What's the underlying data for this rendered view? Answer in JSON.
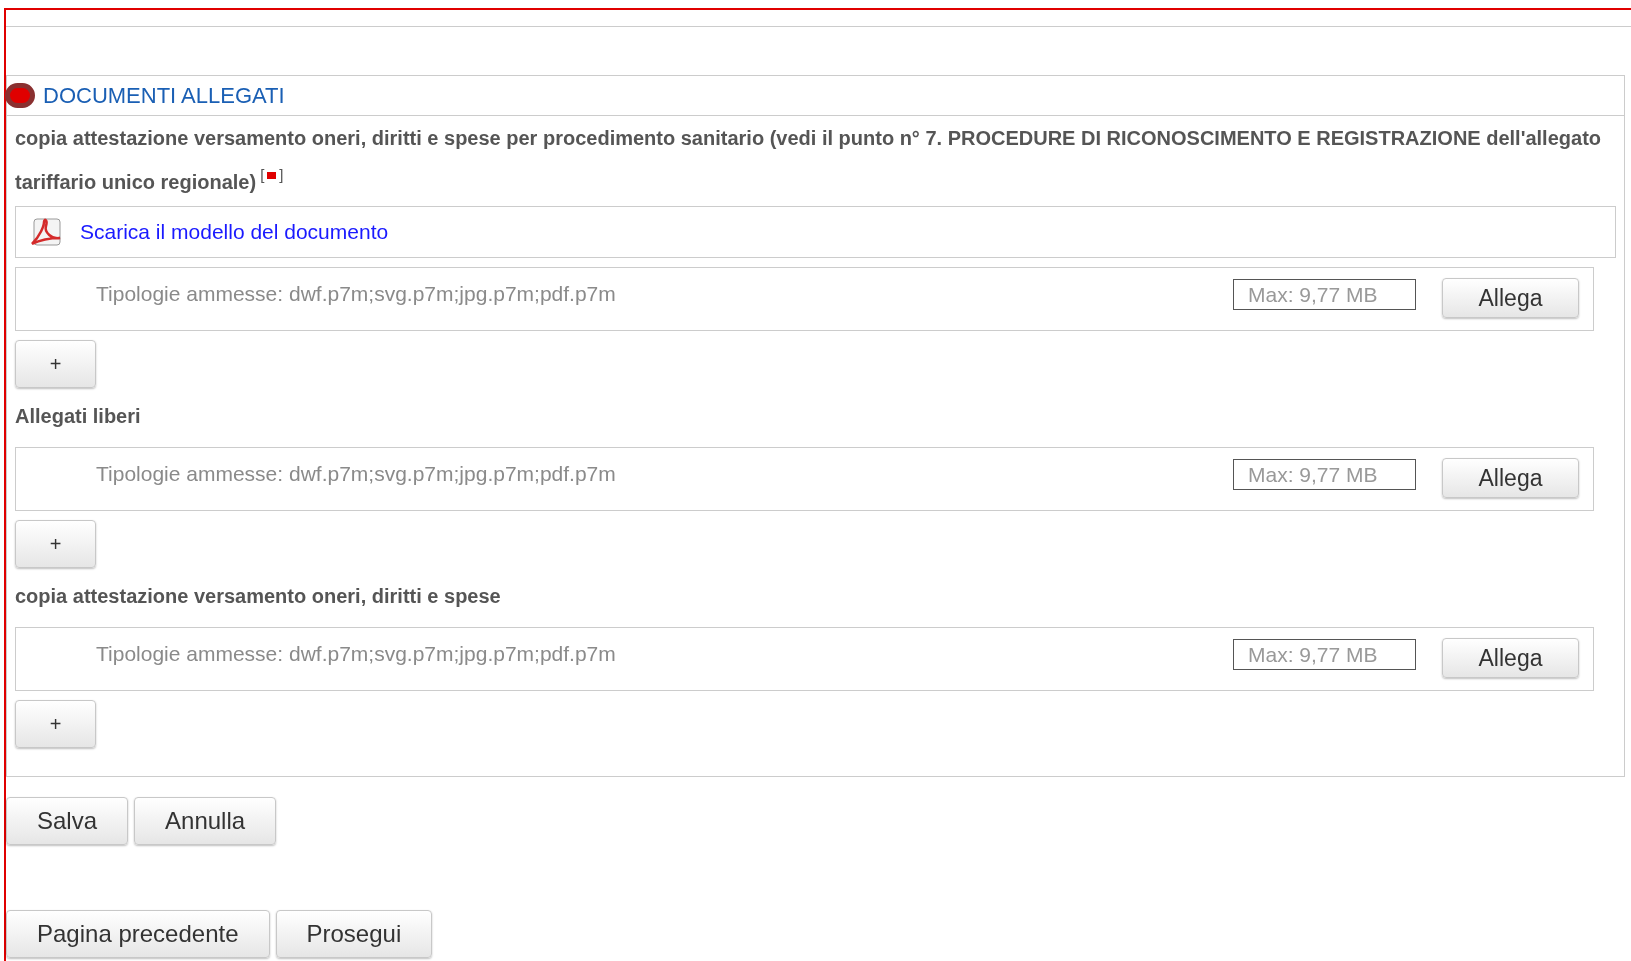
{
  "section": {
    "title": "DOCUMENTI ALLEGATI",
    "groups": [
      {
        "label": "copia attestazione versamento oneri, diritti e spese per procedimento sanitario (vedi il punto n° 7. PROCEDURE DI RICONOSCIMENTO E REGISTRAZIONE dell'allegato tariffario unico regionale)",
        "required_mark": {
          "open": "[",
          "close": "]"
        },
        "template_link": "Scarica il modello del documento",
        "types": "Tipologie ammesse: dwf.p7m;svg.p7m;jpg.p7m;pdf.p7m",
        "max": "Max: 9,77 MB",
        "attach": "Allega",
        "add": "+"
      },
      {
        "label": "Allegati liberi",
        "types": "Tipologie ammesse: dwf.p7m;svg.p7m;jpg.p7m;pdf.p7m",
        "max": "Max: 9,77 MB",
        "attach": "Allega",
        "add": "+"
      },
      {
        "label": "copia attestazione versamento oneri, diritti e spese",
        "types": "Tipologie ammesse: dwf.p7m;svg.p7m;jpg.p7m;pdf.p7m",
        "max": "Max: 9,77 MB",
        "attach": "Allega",
        "add": "+"
      }
    ]
  },
  "form_buttons": [
    "Salva",
    "Annulla"
  ],
  "nav_buttons": [
    "Pagina precedente",
    "Prosegui"
  ]
}
